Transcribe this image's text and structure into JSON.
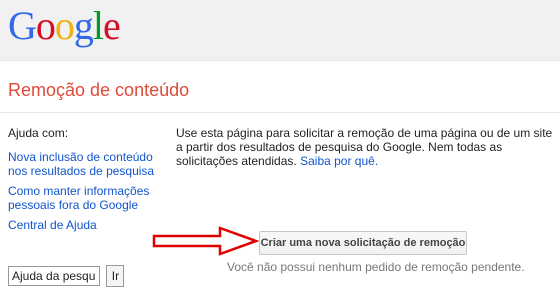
{
  "header": {
    "logo_text": "Google"
  },
  "page": {
    "title": "Remoção de conteúdo"
  },
  "sidebar": {
    "heading": "Ajuda com:",
    "links": [
      "Nova inclusão de conteúdo nos resultados de pesquisa",
      "Como manter informações pessoais fora do Google",
      "Central de Ajuda"
    ],
    "search_value": "Ajuda da pesqu",
    "search_button": "Ir"
  },
  "main": {
    "intro_text": "Use esta página para solicitar a remoção de uma página ou de um site a partir dos resultados de pesquisa do Google. Nem todas as solicitações atendidas.",
    "learn_more": "Saiba por quê.",
    "request_button": "Criar uma nova solicitação de remoção",
    "status_text": "Você não possui nenhum pedido de remoção pendente."
  },
  "colors": {
    "accent_red": "#dd4b39",
    "link_blue": "#1155cc",
    "arrow_red": "#e00000"
  }
}
